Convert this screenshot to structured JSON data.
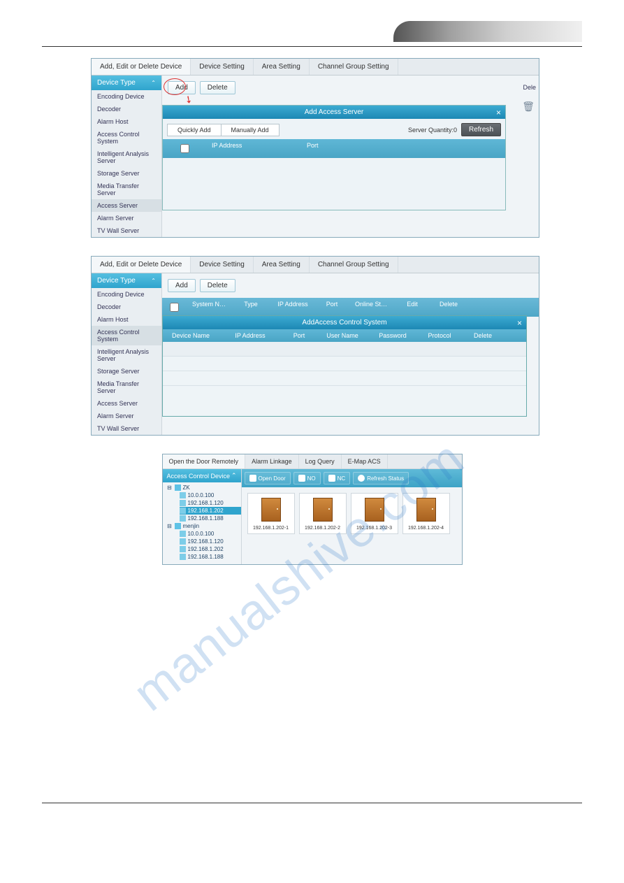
{
  "watermark": "manualshive.com",
  "s1": {
    "tabs": [
      "Add, Edit or Delete Device",
      "Device Setting",
      "Area Setting",
      "Channel Group Setting"
    ],
    "sidebar_title": "Device Type",
    "sidebar": [
      "Encoding Device",
      "Decoder",
      "Alarm Host",
      "Access Control System",
      "Intelligent Analysis Server",
      "Storage Server",
      "Media Transfer Server",
      "Access Server",
      "Alarm Server",
      "TV Wall Server"
    ],
    "sidebar_selected": "Access Server",
    "btn_add": "Add",
    "btn_delete": "Delete",
    "edge_label": "Dele",
    "modal_title": "Add Access Server",
    "sub_quick": "Quickly Add",
    "sub_manual": "Manually Add",
    "server_qty": "Server Quantity:0",
    "btn_refresh": "Refresh",
    "cols": {
      "ip": "IP Address",
      "port": "Port"
    }
  },
  "s2": {
    "tabs": [
      "Add, Edit or Delete Device",
      "Device Setting",
      "Area Setting",
      "Channel Group Setting"
    ],
    "sidebar_title": "Device Type",
    "sidebar": [
      "Encoding Device",
      "Decoder",
      "Alarm Host",
      "Access Control System",
      "Intelligent Analysis Server",
      "Storage Server",
      "Media Transfer Server",
      "Access Server",
      "Alarm Server",
      "TV Wall Server"
    ],
    "sidebar_selected": "Access Control System",
    "btn_add": "Add",
    "btn_delete": "Delete",
    "grid": [
      "",
      "System N…",
      "Type",
      "IP Address",
      "Port",
      "Online St…",
      "Edit",
      "Delete"
    ],
    "modal_title": "AddAccess Control System",
    "cols": [
      "Device Name",
      "IP Address",
      "Port",
      "User Name",
      "Password",
      "Protocol",
      "Delete"
    ]
  },
  "s3": {
    "tabs": [
      "Open the Door Remotely",
      "Alarm Linkage",
      "Log Query",
      "E-Map ACS"
    ],
    "side_title": "Access Control Device",
    "tree": {
      "root1": "ZK",
      "r1children": [
        "10.0.0.100",
        "192.168.1.120",
        "192.168.1.202",
        "192.168.1.188"
      ],
      "r1selected": "192.168.1.202",
      "root2": "menjin",
      "r2children": [
        "10.0.0.100",
        "192.168.1.120",
        "192.168.1.202",
        "192.168.1.188"
      ]
    },
    "tb_open": "Open Door",
    "tb_no": "NO",
    "tb_nc": "NC",
    "tb_refresh": "Refresh Status",
    "doors": [
      "192.168.1.202-1",
      "192.168.1.202-2",
      "192.168.1.202-3",
      "192.168.1.202-4"
    ]
  }
}
